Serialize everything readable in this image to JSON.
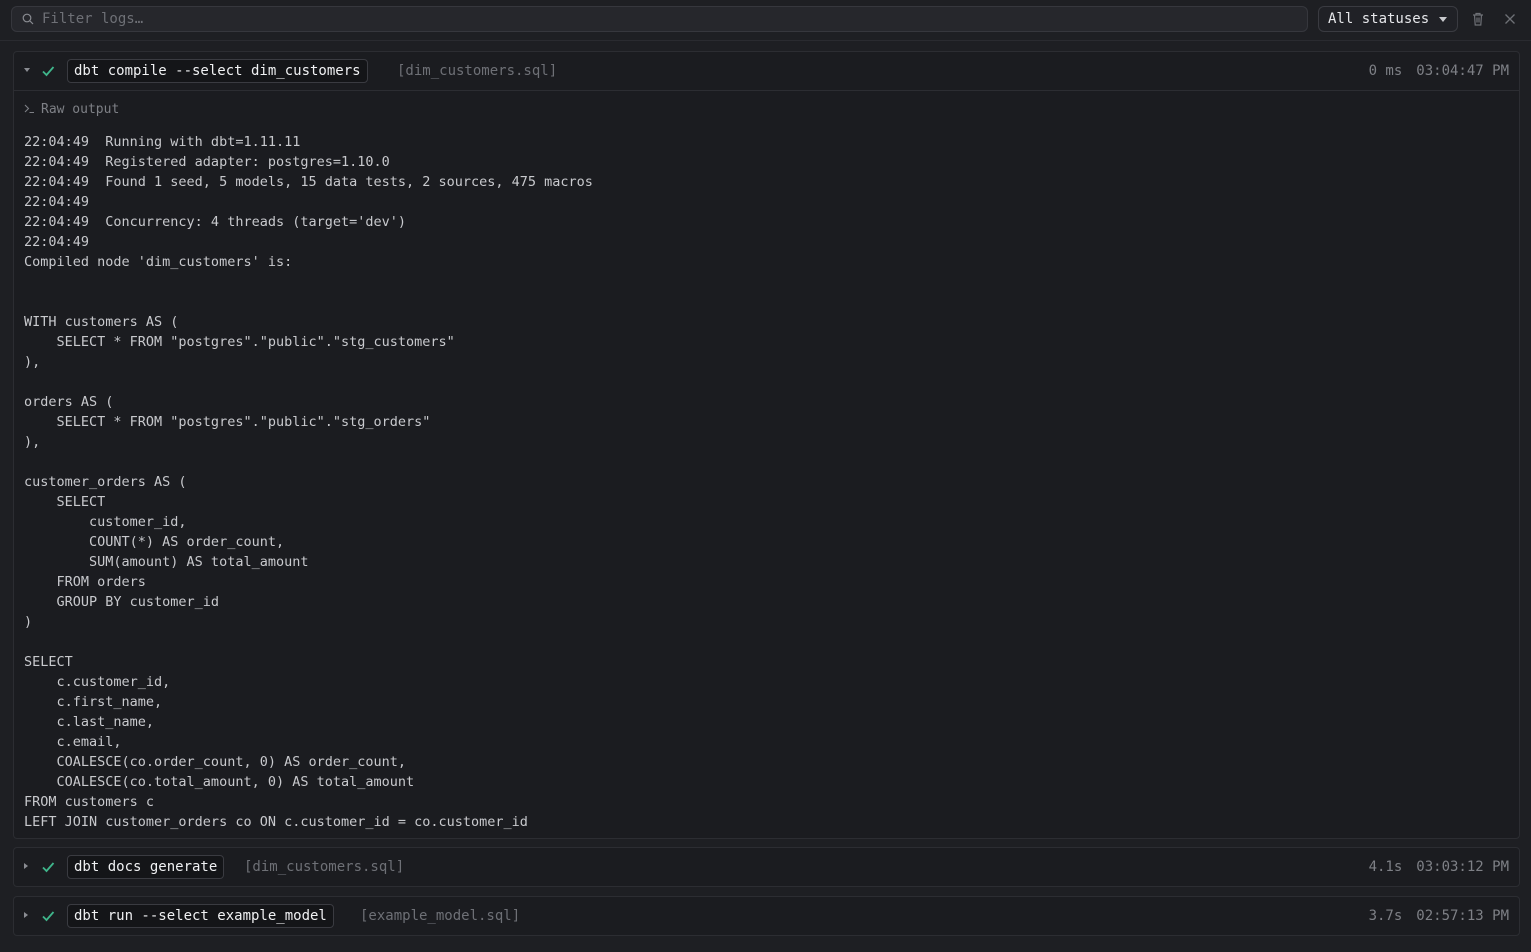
{
  "toolbar": {
    "search_placeholder": "Filter logs…",
    "status_filter": "All statuses"
  },
  "logs": [
    {
      "command": "dbt compile --select dim_customers",
      "file": "[dim_customers.sql]",
      "duration": "0 ms",
      "time": "03:04:47 PM",
      "status": "success",
      "expanded": true,
      "raw_label": "Raw output",
      "output": "22:04:49  Running with dbt=1.11.11\n22:04:49  Registered adapter: postgres=1.10.0\n22:04:49  Found 1 seed, 5 models, 15 data tests, 2 sources, 475 macros\n22:04:49\n22:04:49  Concurrency: 4 threads (target='dev')\n22:04:49\nCompiled node 'dim_customers' is:\n\n\nWITH customers AS (\n    SELECT * FROM \"postgres\".\"public\".\"stg_customers\"\n),\n\norders AS (\n    SELECT * FROM \"postgres\".\"public\".\"stg_orders\"\n),\n\ncustomer_orders AS (\n    SELECT\n        customer_id,\n        COUNT(*) AS order_count,\n        SUM(amount) AS total_amount\n    FROM orders\n    GROUP BY customer_id\n)\n\nSELECT\n    c.customer_id,\n    c.first_name,\n    c.last_name,\n    c.email,\n    COALESCE(co.order_count, 0) AS order_count,\n    COALESCE(co.total_amount, 0) AS total_amount\nFROM customers c\nLEFT JOIN customer_orders co ON c.customer_id = co.customer_id"
    },
    {
      "command": "dbt docs generate",
      "file": "[dim_customers.sql]",
      "duration": "4.1s",
      "time": "03:03:12 PM",
      "status": "success",
      "expanded": false
    },
    {
      "command": "dbt run --select example_model",
      "file": "[example_model.sql]",
      "duration": "3.7s",
      "time": "02:57:13 PM",
      "status": "success",
      "expanded": false
    }
  ],
  "colors": {
    "success": "#3fb68b",
    "background": "#1e1f23"
  }
}
